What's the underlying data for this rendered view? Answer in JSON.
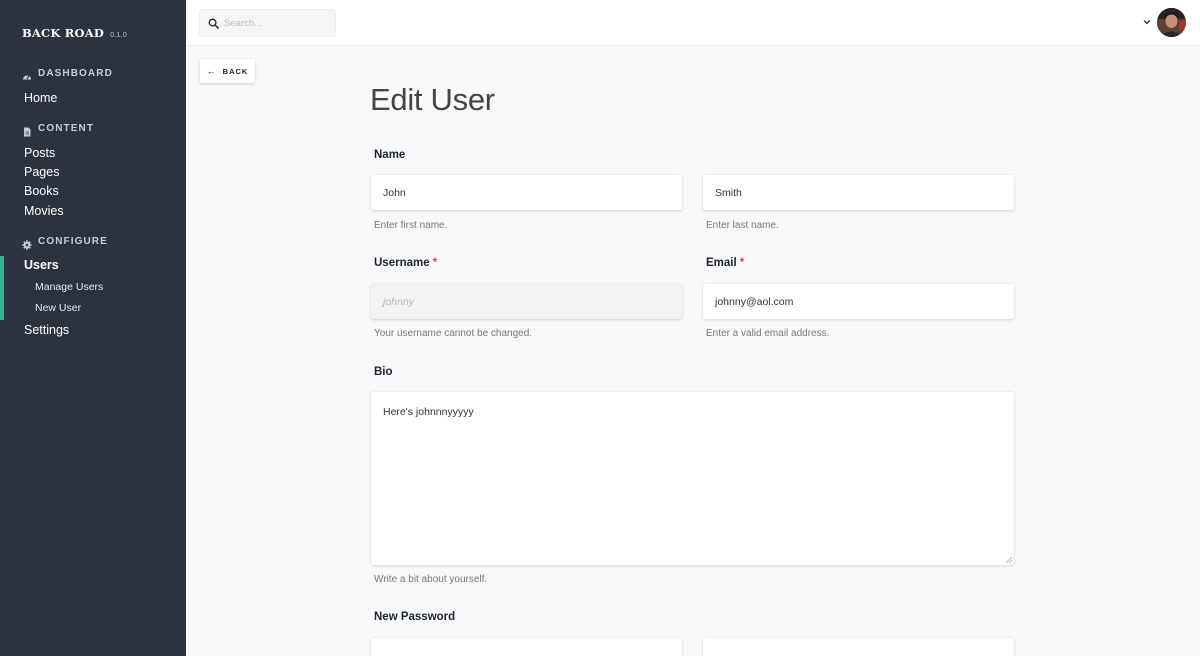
{
  "app": {
    "name": "BACK ROAD",
    "version": "0.1.0"
  },
  "sidebar": {
    "sections": [
      {
        "label": "DASHBOARD",
        "icon": "gauge-icon"
      },
      {
        "label": "CONTENT",
        "icon": "document-icon"
      },
      {
        "label": "CONFIGURE",
        "icon": "gear-icon"
      }
    ],
    "items": {
      "home": "Home",
      "posts": "Posts",
      "pages": "Pages",
      "books": "Books",
      "movies": "Movies",
      "users": "Users",
      "manage_users": "Manage Users",
      "new_user": "New User",
      "settings": "Settings"
    },
    "active_item": "Users",
    "accent_color": "#2fb68e"
  },
  "topbar": {
    "search_placeholder": "Search..."
  },
  "back_button": {
    "label": "BACK"
  },
  "page": {
    "title": "Edit User"
  },
  "form": {
    "name": {
      "label": "Name",
      "first_value": "John",
      "first_help": "Enter first name.",
      "last_value": "Smith",
      "last_help": "Enter last name."
    },
    "username": {
      "label": "Username",
      "required_mark": "*",
      "placeholder": "johnny",
      "help": "Your username cannot be changed."
    },
    "email": {
      "label": "Email",
      "required_mark": "*",
      "value": "johnny@aol.com",
      "help": "Enter a valid email address."
    },
    "bio": {
      "label": "Bio",
      "value": "Here's johnnnyyyyy",
      "help": "Write a bit about yourself."
    },
    "new_password": {
      "label": "New Password"
    }
  }
}
